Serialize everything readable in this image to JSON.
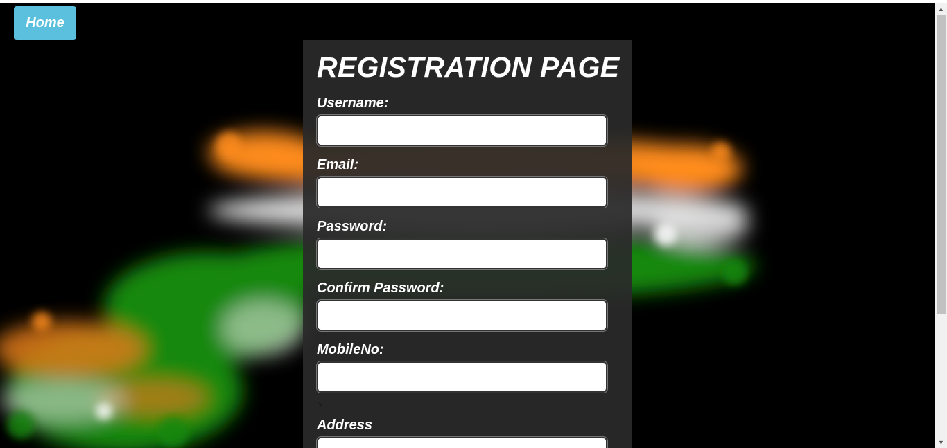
{
  "nav": {
    "home_label": "Home"
  },
  "form": {
    "title": "REGISTRATION PAGE",
    "fields": [
      {
        "label": "Username:",
        "value": ""
      },
      {
        "label": "Email:",
        "value": ""
      },
      {
        "label": "Password:",
        "value": ""
      },
      {
        "label": "Confirm Password:",
        "value": ""
      },
      {
        "label": "MobileNo:",
        "value": ""
      },
      {
        "label": "Address",
        "value": ""
      }
    ],
    "stray_mark": ">"
  },
  "colors": {
    "home_button": "#5bc0de",
    "panel": "#2a2a2a",
    "page_background": "#000000",
    "smoke_saffron": "#ff8c1a",
    "smoke_white": "#f0f0f0",
    "smoke_green": "#138808"
  },
  "icons": {
    "scroll_up": "triangle-up",
    "scroll_down": "triangle-down"
  }
}
